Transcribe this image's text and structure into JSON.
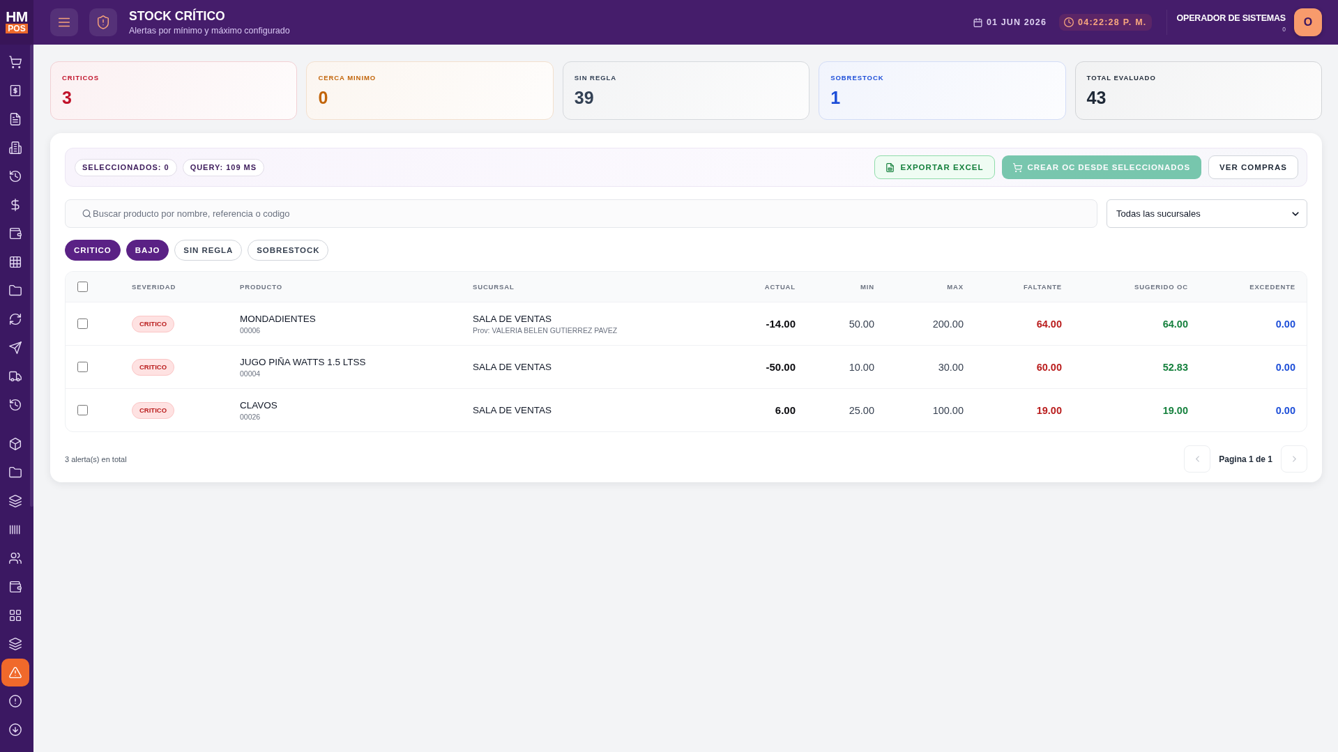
{
  "sidebar": {
    "logo": {
      "top": "HM",
      "bottom": "POS"
    },
    "groups": [
      {
        "items": [
          {
            "selected": false
          },
          {
            "selected": false
          },
          {
            "selected": false
          },
          {
            "selected": false
          },
          {
            "selected": false
          },
          {
            "selected": false
          },
          {
            "selected": false
          },
          {
            "selected": false
          },
          {
            "selected": false
          },
          {
            "selected": false
          },
          {
            "selected": false
          },
          {
            "selected": false
          },
          {
            "selected": false
          }
        ]
      },
      {
        "items": [
          {
            "selected": false
          },
          {
            "selected": false
          },
          {
            "selected": false
          },
          {
            "selected": false
          },
          {
            "selected": false
          },
          {
            "selected": false
          },
          {
            "selected": false
          },
          {
            "selected": false
          },
          {
            "selected": true
          },
          {
            "selected": false
          },
          {
            "selected": false
          }
        ]
      }
    ]
  },
  "header": {
    "title": "STOCK CRÍTICO",
    "subtitle": "Alertas por mínimo y máximo configurado",
    "date": "01 JUN 2026",
    "time": "04:22:28 P. M.",
    "user": {
      "name": "OPERADOR DE SISTEMAS",
      "detail": "0",
      "initial": "O"
    }
  },
  "summary_cards": [
    {
      "label": "CRITICOS",
      "value": "3",
      "color": "#c0122a"
    },
    {
      "label": "CERCA MINIMO",
      "value": "0",
      "color": "#c2650a"
    },
    {
      "label": "SIN REGLA",
      "value": "39",
      "color": "#334155"
    },
    {
      "label": "SOBRESTOCK",
      "value": "1",
      "color": "#1d4ed8"
    },
    {
      "label": "TOTAL EVALUADO",
      "value": "43",
      "color": "#1f2937"
    }
  ],
  "toolbar": {
    "badges": [
      "SELECCIONADOS: 0",
      "QUERY: 109 MS"
    ],
    "buttons": [
      {
        "label": "EXPORTAR EXCEL",
        "kind": "export",
        "disabled": false
      },
      {
        "label": "CREAR OC DESDE SELECCIONADOS",
        "kind": "primary",
        "disabled": true
      },
      {
        "label": "VER COMPRAS",
        "kind": "plain",
        "disabled": false
      }
    ]
  },
  "search": {
    "placeholder": "Buscar producto por nombre, referencia o codigo"
  },
  "branch_select": {
    "value": "Todas las sucursales"
  },
  "filters": [
    {
      "label": "CRITICO",
      "selected": true
    },
    {
      "label": "BAJO",
      "selected": true
    },
    {
      "label": "SIN REGLA",
      "selected": false
    },
    {
      "label": "SOBRESTOCK",
      "selected": false
    }
  ],
  "table": {
    "select_all_checked": false,
    "columns": [
      "SEVERIDAD",
      "PRODUCTO",
      "SUCURSAL",
      "ACTUAL",
      "MIN",
      "MAX",
      "FALTANTE",
      "SUGERIDO OC",
      "EXCEDENTE"
    ],
    "rows": [
      {
        "checked": false,
        "severity": "CRITICO",
        "product": "MONDADIENTES",
        "code": "00006",
        "branch": "SALA DE VENTAS",
        "supplier": "Prov: VALERIA BELEN GUTIERREZ PAVEZ",
        "actual": "-14.00",
        "min": "50.00",
        "max": "200.00",
        "shortage": "64.00",
        "suggested": "64.00",
        "excess": "0.00"
      },
      {
        "checked": false,
        "severity": "CRITICO",
        "product": "JUGO PIÑA WATTS 1.5 LTSS",
        "code": "00004",
        "branch": "SALA DE VENTAS",
        "actual": "-50.00",
        "min": "10.00",
        "max": "30.00",
        "shortage": "60.00",
        "suggested": "52.83",
        "excess": "0.00"
      },
      {
        "checked": false,
        "severity": "CRITICO",
        "product": "CLAVOS",
        "code": "00026",
        "branch": "SALA DE VENTAS",
        "actual": "6.00",
        "min": "25.00",
        "max": "100.00",
        "shortage": "19.00",
        "suggested": "19.00",
        "excess": "0.00"
      }
    ]
  },
  "footer": {
    "total": "3 alerta(s) en total",
    "pagination": {
      "label": "Pagina 1 de 1",
      "previous": {
        "disabled": true
      },
      "next": {
        "disabled": true
      }
    }
  }
}
